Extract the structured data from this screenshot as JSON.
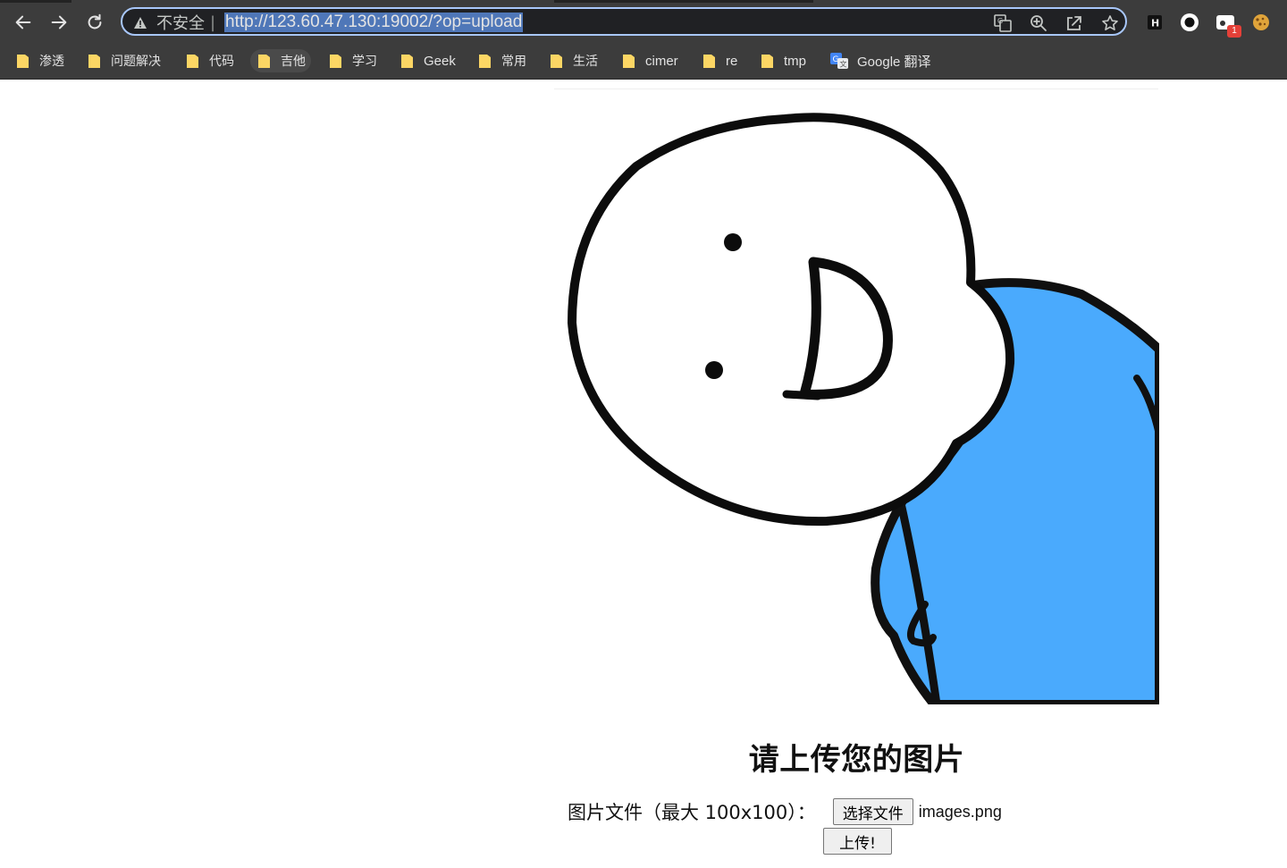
{
  "browser": {
    "security_label": "不安全",
    "url": "http://123.60.47.130:19002/?op=upload",
    "extension_badge": "1",
    "icons": {
      "back": "arrow-left-icon",
      "forward": "arrow-right-icon",
      "reload": "reload-icon",
      "security": "warning-triangle-icon",
      "translate": "translate-icon",
      "zoom": "zoom-in-icon",
      "share": "share-icon",
      "bookmark": "star-icon"
    },
    "colors": {
      "chrome": "#3c3c3c",
      "omnibox_border": "#a8c7fa",
      "url_highlight": "#4f77b8",
      "folder": "#fcd664"
    }
  },
  "bookmarks": [
    {
      "label": "渗透"
    },
    {
      "label": "问题解决"
    },
    {
      "label": "代码"
    },
    {
      "label": "吉他"
    },
    {
      "label": "学习"
    },
    {
      "label": "Geek"
    },
    {
      "label": "常用"
    },
    {
      "label": "生活"
    },
    {
      "label": "cimer"
    },
    {
      "label": "re"
    },
    {
      "label": "tmp"
    },
    {
      "label": "Google 翻译"
    }
  ],
  "page": {
    "heading": "请上传您的图片",
    "file_label": "图片文件（最大 100x100）：",
    "choose_button": "选择文件",
    "selected_file": "images.png",
    "submit_button": "上传!",
    "image": {
      "subject": "smiling-stickman-meme",
      "shirt_color": "#4aaafd"
    }
  }
}
